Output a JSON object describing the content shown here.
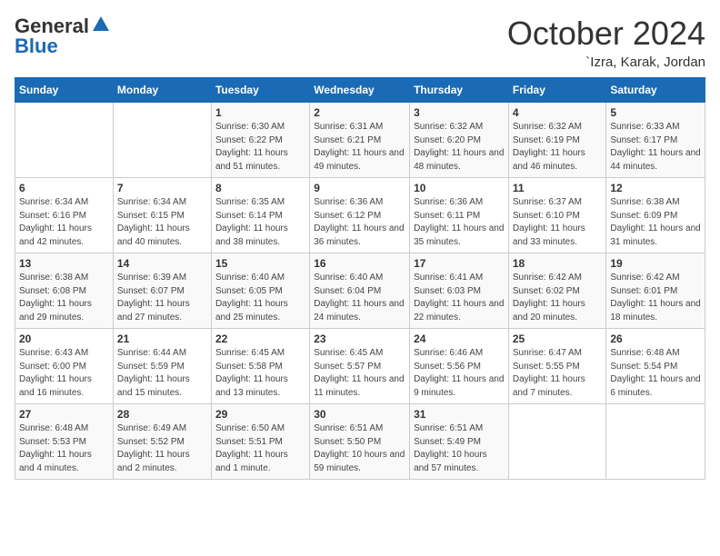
{
  "header": {
    "logo_general": "General",
    "logo_blue": "Blue",
    "month": "October 2024",
    "location": "`Izra, Karak, Jordan"
  },
  "days_of_week": [
    "Sunday",
    "Monday",
    "Tuesday",
    "Wednesday",
    "Thursday",
    "Friday",
    "Saturday"
  ],
  "weeks": [
    [
      {
        "num": "",
        "info": ""
      },
      {
        "num": "",
        "info": ""
      },
      {
        "num": "1",
        "info": "Sunrise: 6:30 AM\nSunset: 6:22 PM\nDaylight: 11 hours and 51 minutes."
      },
      {
        "num": "2",
        "info": "Sunrise: 6:31 AM\nSunset: 6:21 PM\nDaylight: 11 hours and 49 minutes."
      },
      {
        "num": "3",
        "info": "Sunrise: 6:32 AM\nSunset: 6:20 PM\nDaylight: 11 hours and 48 minutes."
      },
      {
        "num": "4",
        "info": "Sunrise: 6:32 AM\nSunset: 6:19 PM\nDaylight: 11 hours and 46 minutes."
      },
      {
        "num": "5",
        "info": "Sunrise: 6:33 AM\nSunset: 6:17 PM\nDaylight: 11 hours and 44 minutes."
      }
    ],
    [
      {
        "num": "6",
        "info": "Sunrise: 6:34 AM\nSunset: 6:16 PM\nDaylight: 11 hours and 42 minutes."
      },
      {
        "num": "7",
        "info": "Sunrise: 6:34 AM\nSunset: 6:15 PM\nDaylight: 11 hours and 40 minutes."
      },
      {
        "num": "8",
        "info": "Sunrise: 6:35 AM\nSunset: 6:14 PM\nDaylight: 11 hours and 38 minutes."
      },
      {
        "num": "9",
        "info": "Sunrise: 6:36 AM\nSunset: 6:12 PM\nDaylight: 11 hours and 36 minutes."
      },
      {
        "num": "10",
        "info": "Sunrise: 6:36 AM\nSunset: 6:11 PM\nDaylight: 11 hours and 35 minutes."
      },
      {
        "num": "11",
        "info": "Sunrise: 6:37 AM\nSunset: 6:10 PM\nDaylight: 11 hours and 33 minutes."
      },
      {
        "num": "12",
        "info": "Sunrise: 6:38 AM\nSunset: 6:09 PM\nDaylight: 11 hours and 31 minutes."
      }
    ],
    [
      {
        "num": "13",
        "info": "Sunrise: 6:38 AM\nSunset: 6:08 PM\nDaylight: 11 hours and 29 minutes."
      },
      {
        "num": "14",
        "info": "Sunrise: 6:39 AM\nSunset: 6:07 PM\nDaylight: 11 hours and 27 minutes."
      },
      {
        "num": "15",
        "info": "Sunrise: 6:40 AM\nSunset: 6:05 PM\nDaylight: 11 hours and 25 minutes."
      },
      {
        "num": "16",
        "info": "Sunrise: 6:40 AM\nSunset: 6:04 PM\nDaylight: 11 hours and 24 minutes."
      },
      {
        "num": "17",
        "info": "Sunrise: 6:41 AM\nSunset: 6:03 PM\nDaylight: 11 hours and 22 minutes."
      },
      {
        "num": "18",
        "info": "Sunrise: 6:42 AM\nSunset: 6:02 PM\nDaylight: 11 hours and 20 minutes."
      },
      {
        "num": "19",
        "info": "Sunrise: 6:42 AM\nSunset: 6:01 PM\nDaylight: 11 hours and 18 minutes."
      }
    ],
    [
      {
        "num": "20",
        "info": "Sunrise: 6:43 AM\nSunset: 6:00 PM\nDaylight: 11 hours and 16 minutes."
      },
      {
        "num": "21",
        "info": "Sunrise: 6:44 AM\nSunset: 5:59 PM\nDaylight: 11 hours and 15 minutes."
      },
      {
        "num": "22",
        "info": "Sunrise: 6:45 AM\nSunset: 5:58 PM\nDaylight: 11 hours and 13 minutes."
      },
      {
        "num": "23",
        "info": "Sunrise: 6:45 AM\nSunset: 5:57 PM\nDaylight: 11 hours and 11 minutes."
      },
      {
        "num": "24",
        "info": "Sunrise: 6:46 AM\nSunset: 5:56 PM\nDaylight: 11 hours and 9 minutes."
      },
      {
        "num": "25",
        "info": "Sunrise: 6:47 AM\nSunset: 5:55 PM\nDaylight: 11 hours and 7 minutes."
      },
      {
        "num": "26",
        "info": "Sunrise: 6:48 AM\nSunset: 5:54 PM\nDaylight: 11 hours and 6 minutes."
      }
    ],
    [
      {
        "num": "27",
        "info": "Sunrise: 6:48 AM\nSunset: 5:53 PM\nDaylight: 11 hours and 4 minutes."
      },
      {
        "num": "28",
        "info": "Sunrise: 6:49 AM\nSunset: 5:52 PM\nDaylight: 11 hours and 2 minutes."
      },
      {
        "num": "29",
        "info": "Sunrise: 6:50 AM\nSunset: 5:51 PM\nDaylight: 11 hours and 1 minute."
      },
      {
        "num": "30",
        "info": "Sunrise: 6:51 AM\nSunset: 5:50 PM\nDaylight: 10 hours and 59 minutes."
      },
      {
        "num": "31",
        "info": "Sunrise: 6:51 AM\nSunset: 5:49 PM\nDaylight: 10 hours and 57 minutes."
      },
      {
        "num": "",
        "info": ""
      },
      {
        "num": "",
        "info": ""
      }
    ]
  ]
}
